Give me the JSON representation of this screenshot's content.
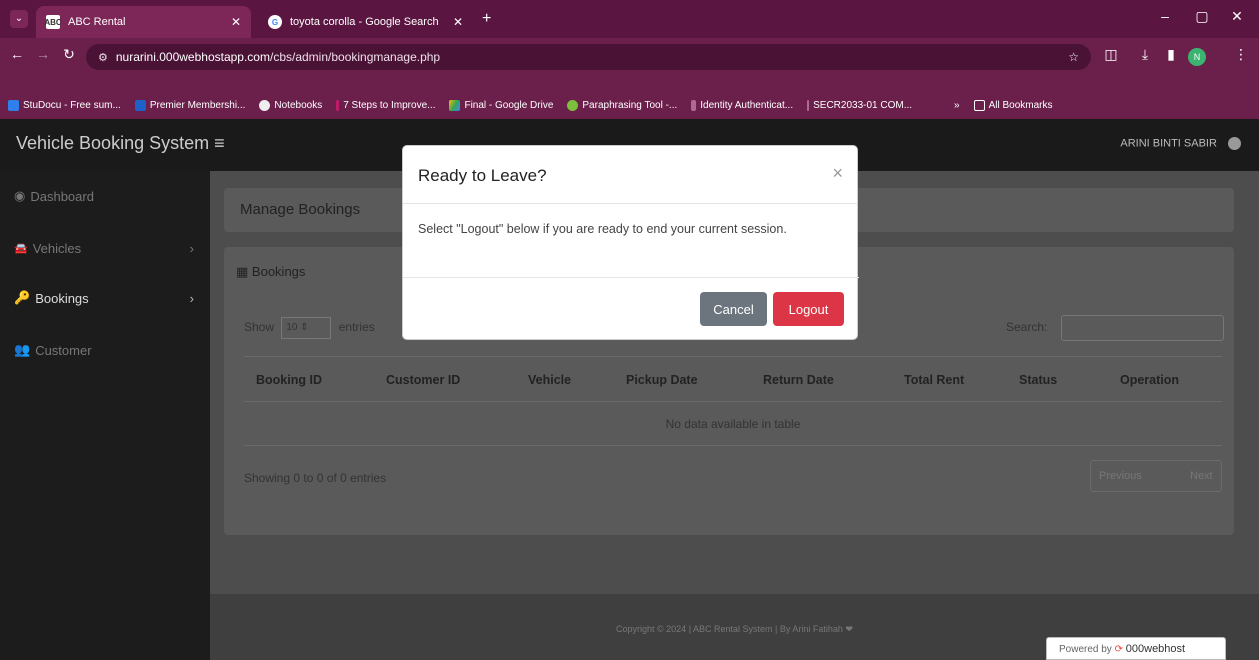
{
  "browser": {
    "tabs": [
      {
        "label": "ABC Rental",
        "favicon": "ABC"
      },
      {
        "label": "toyota corolla - Google Search"
      }
    ],
    "url_host": "nurarini.000webhostapp.com",
    "url_path": "/cbs/admin/bookingmanage.php",
    "profile_initial": "N",
    "bookmarks": [
      "StuDocu - Free sum...",
      "Premier Membershi...",
      "Notebooks",
      "7 Steps to Improve...",
      "Final - Google Drive",
      "Paraphrasing Tool -...",
      "Identity Authenticat...",
      "SECR2033-01 COM..."
    ],
    "more_label": "»",
    "all_bookmarks": "All Bookmarks"
  },
  "app": {
    "brand": "Vehicle Booking System",
    "menu_icon": "≡",
    "user": "ARINI BINTI SABIR"
  },
  "sidebar": {
    "items": [
      {
        "label": "Dashboard",
        "icon": "dashboard-icon"
      },
      {
        "label": "Vehicles",
        "icon": "car-icon"
      },
      {
        "label": "Bookings",
        "icon": "key-icon"
      },
      {
        "label": "Customer",
        "icon": "users-icon"
      }
    ]
  },
  "content": {
    "breadcrumb": "Manage Bookings",
    "card_title": "Bookings",
    "show": "Show",
    "entries_value": "10",
    "entries": "entries",
    "search_label": "Search:",
    "columns": [
      "Booking ID",
      "Customer ID",
      "Vehicle",
      "Pickup Date",
      "Return Date",
      "Total Rent",
      "Status",
      "Operation"
    ],
    "empty": "No data available in table",
    "info": "Showing 0 to 0 of 0 entries",
    "prev": "Previous",
    "next": "Next"
  },
  "footer": {
    "copyright": "Copyright © 2024 | ABC Rental System | By Arini Fatihah ❤",
    "powered_by": "Powered by",
    "powered_brand": "000webhost"
  },
  "modal": {
    "title": "Ready to Leave?",
    "close": "×",
    "body": "Select \"Logout\" below if you are ready to end your current session.",
    "cancel": "Cancel",
    "logout": "Logout"
  },
  "colors": {
    "logout": "#dc3545",
    "cancel": "#6c757d"
  }
}
